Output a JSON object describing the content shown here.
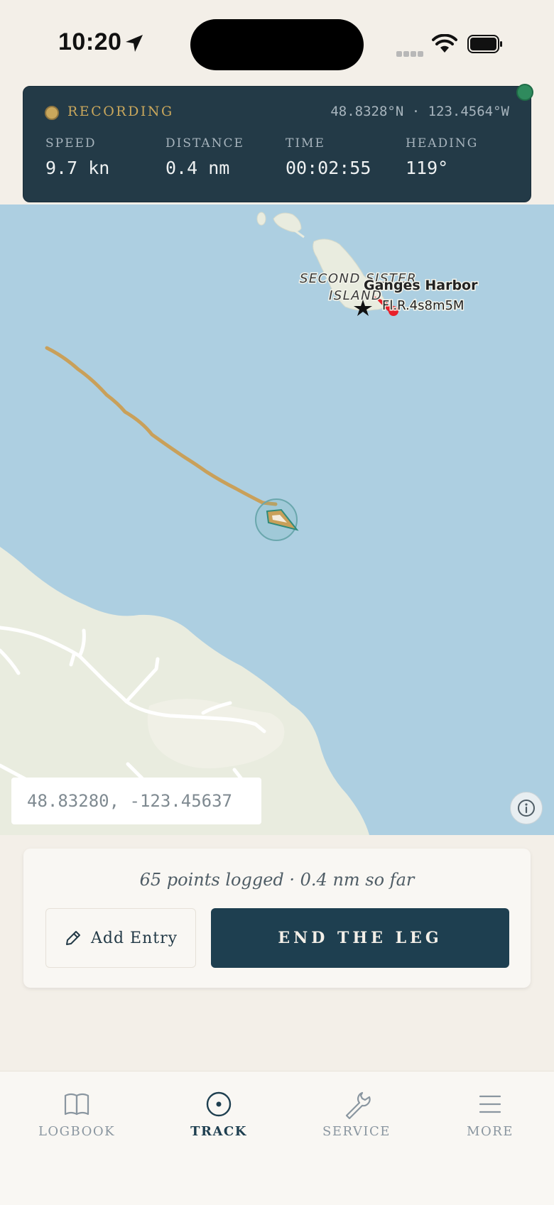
{
  "status_bar": {
    "time": "10:20"
  },
  "recording": {
    "label": "RECORDING",
    "coords": "48.8328°N · 123.4564°W",
    "stats": [
      {
        "label": "SPEED",
        "value": "9.7 kn"
      },
      {
        "label": "DISTANCE",
        "value": "0.4 nm"
      },
      {
        "label": "TIME",
        "value": "00:02:55"
      },
      {
        "label": "HEADING",
        "value": "119°"
      }
    ]
  },
  "map": {
    "island_label_line1": "SECOND SISTER",
    "island_label_line2": "ISLAND",
    "harbor_name": "Ganges Harbor",
    "light_characteristic": "Fl.R.4s8m5M",
    "coord_readout": "48.83280, -123.45637",
    "colors": {
      "water": "#adcfe1",
      "land": "#e9ecdf",
      "track": "#c9a05a"
    }
  },
  "action_card": {
    "points_text": "65 points logged · 0.4 nm so far",
    "add_entry_label": "Add Entry",
    "end_leg_label": "END THE LEG"
  },
  "tabs": [
    {
      "label": "LOGBOOK",
      "icon": "book-icon"
    },
    {
      "label": "TRACK",
      "icon": "target-icon",
      "active": true
    },
    {
      "label": "SERVICE",
      "icon": "wrench-icon"
    },
    {
      "label": "MORE",
      "icon": "menu-icon"
    }
  ]
}
